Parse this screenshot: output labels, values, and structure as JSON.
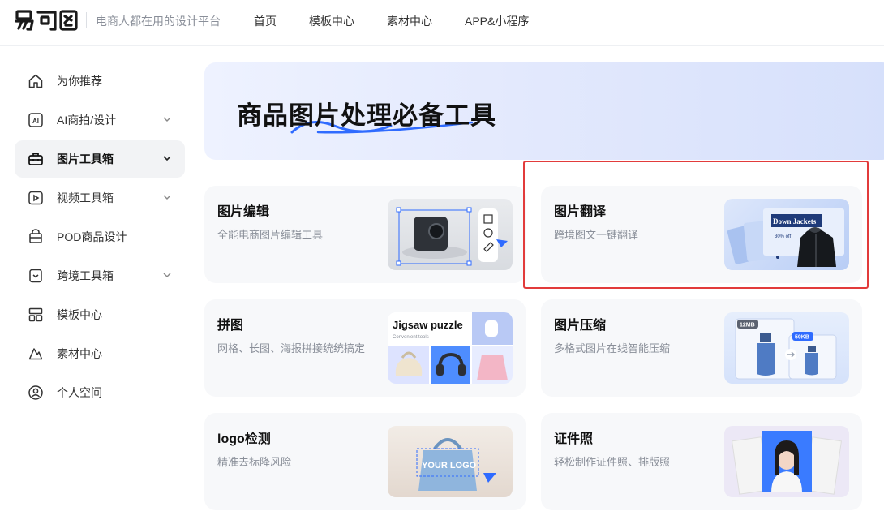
{
  "header": {
    "logo_text": "易可图",
    "slogan": "电商人都在用的设计平台",
    "nav": [
      {
        "label": "首页"
      },
      {
        "label": "模板中心"
      },
      {
        "label": "素材中心"
      },
      {
        "label": "APP&小程序"
      }
    ]
  },
  "sidebar": {
    "items": [
      {
        "label": "为你推荐",
        "icon": "home-icon",
        "expandable": false,
        "active": false
      },
      {
        "label": "AI商拍/设计",
        "icon": "ai-icon",
        "expandable": true,
        "active": false
      },
      {
        "label": "图片工具箱",
        "icon": "toolbox-icon",
        "expandable": true,
        "active": true
      },
      {
        "label": "视频工具箱",
        "icon": "video-icon",
        "expandable": true,
        "active": false
      },
      {
        "label": "POD商品设计",
        "icon": "bag-icon",
        "expandable": false,
        "active": false
      },
      {
        "label": "跨境工具箱",
        "icon": "bookmark-icon",
        "expandable": true,
        "active": false
      },
      {
        "label": "模板中心",
        "icon": "template-icon",
        "expandable": false,
        "active": false
      },
      {
        "label": "素材中心",
        "icon": "material-icon",
        "expandable": false,
        "active": false
      },
      {
        "label": "个人空间",
        "icon": "user-icon",
        "expandable": false,
        "active": false
      }
    ]
  },
  "banner": {
    "title": "商品图片处理必备工具"
  },
  "cards": [
    {
      "title": "图片编辑",
      "desc": "全能电商图片编辑工具"
    },
    {
      "title": "图片翻译",
      "desc": "跨境图文一键翻译",
      "thumb_text": "Down Jackets",
      "thumb_sub": "30% off"
    },
    {
      "title": "拼图",
      "desc": "网格、长图、海报拼接统统搞定",
      "thumb_text": "Jigsaw puzzle",
      "thumb_sub": "Convenient tools"
    },
    {
      "title": "图片压缩",
      "desc": "多格式图片在线智能压缩",
      "thumb_before": "12MB",
      "thumb_after": "50KB"
    },
    {
      "title": "logo检测",
      "desc": "精准去标降风险",
      "thumb_text": "YOUR LOGO"
    },
    {
      "title": "证件照",
      "desc": "轻松制作证件照、排版照"
    }
  ],
  "colors": {
    "accent": "#2f6bff",
    "highlight_border": "#e23b3b",
    "card_bg": "#f7f8fa"
  }
}
